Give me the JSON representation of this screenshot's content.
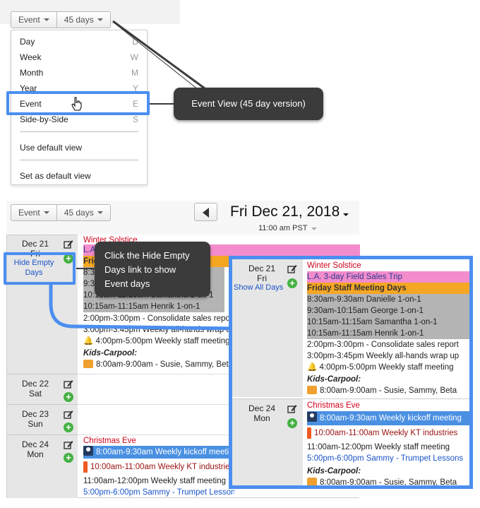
{
  "top_selector": {
    "view": "Event",
    "range": "45 days"
  },
  "menu": {
    "items": [
      {
        "label": "Day",
        "shortcut": "D"
      },
      {
        "label": "Week",
        "shortcut": "W"
      },
      {
        "label": "Month",
        "shortcut": "M"
      },
      {
        "label": "Year",
        "shortcut": "Y"
      },
      {
        "label": "Event",
        "shortcut": "E"
      },
      {
        "label": "Side-by-Side",
        "shortcut": "S"
      }
    ],
    "use_default": "Use default view",
    "set_default": "Set as default view"
  },
  "tooltip_event_view": "Event View (45 day version)",
  "tooltip_hide_empty": "Click the Hide Empty Days link to show Event days",
  "toolbar": {
    "view": "Event",
    "range": "45 days",
    "date_title": "Fri Dec 21, 2018",
    "time": "11:00 am PST"
  },
  "calendar": {
    "hide_empty": "Hide Empty Days",
    "show_all": "Show All Days",
    "days": [
      {
        "date": "Dec 21",
        "dow": "Fri"
      },
      {
        "date": "Dec 22",
        "dow": "Sat"
      },
      {
        "date": "Dec 23",
        "dow": "Sun"
      },
      {
        "date": "Dec 24",
        "dow": "Mon"
      }
    ],
    "dec21_events": [
      "Winter Solstice",
      "L.A. 3-day Field Sales Trip",
      "Friday Staff Meeting Days",
      "8:30am-9:30am   Danielle 1-on-1",
      "9:30am-10:15am   George 1-on-1",
      "10:15am-11:15am   Samantha 1-on-1",
      "10:15am-11:15am   Henrik 1-on-1",
      "2:00pm-3:00pm   - Consolidate sales report",
      "3:00pm-3:45pm   Weekly all-hands wrap up",
      "4:00pm-5:00pm   Weekly staff meeting",
      "Kids-Carpool:",
      "8:00am-9:00am   - Susie, Sammy, Beta"
    ],
    "dec24_events": [
      "Christmas Eve",
      "8:00am-9:30am   Weekly kickoff meeting",
      "10:00am-11:00am   Weekly KT industries",
      "11:00am-12:00pm   Weekly staff meeting",
      "5:00pm-6:00pm   Sammy - Trumpet Lessons",
      "Kids-Carpool:",
      "8:00am-9:00am   - Susie, Sammy, Beta"
    ]
  },
  "colors": {
    "highlight": "#4b8ef0",
    "tooltip": "#3b3b3b",
    "holiday": "#d0021b",
    "trip": "#f38ccd",
    "staff": "#f5a623",
    "meeting": "#b4b4b4",
    "kickoff": "#4a90e2"
  }
}
